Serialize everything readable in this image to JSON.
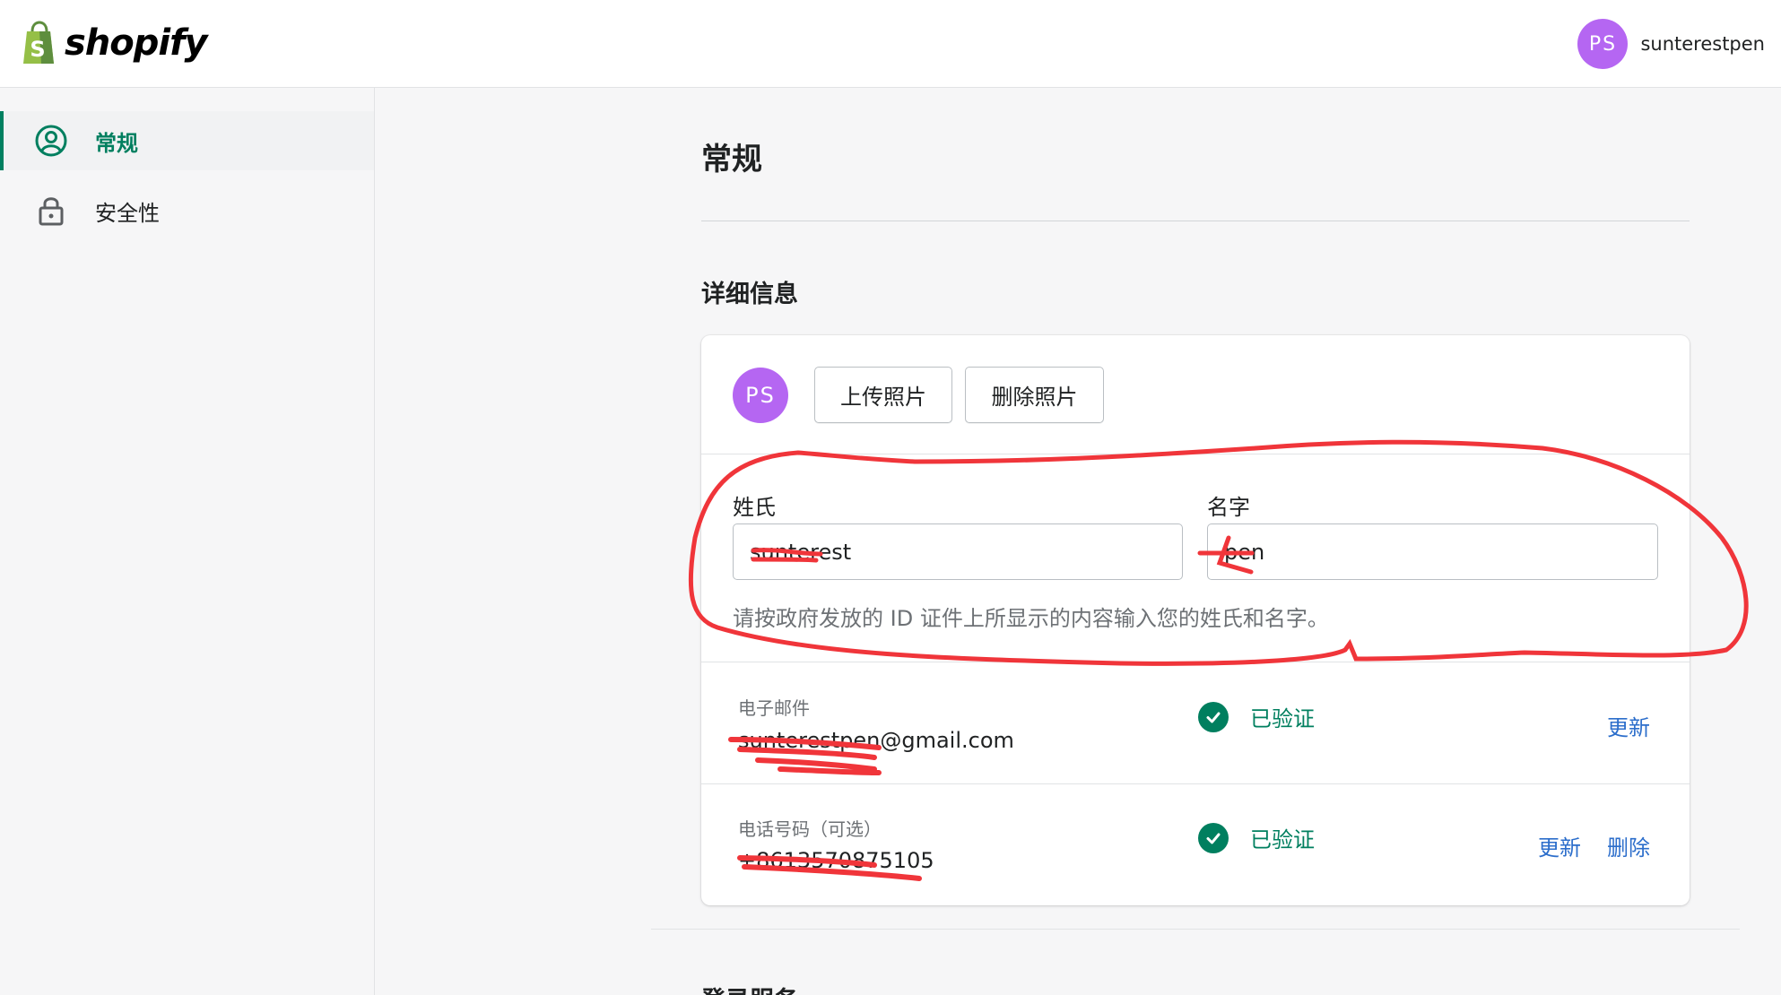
{
  "header": {
    "brand": "shopify",
    "user_initials": "PS",
    "user_name": "sunterestpen"
  },
  "sidebar": {
    "items": [
      {
        "label": "常规",
        "icon": "user-circle-icon",
        "active": true
      },
      {
        "label": "安全性",
        "icon": "lock-icon",
        "active": false
      }
    ]
  },
  "main": {
    "title": "常规",
    "details": {
      "title": "详细信息",
      "avatar_initials": "PS",
      "upload_photo_label": "上传照片",
      "delete_photo_label": "删除照片",
      "last_name_label": "姓氏",
      "last_name_value": "sunterest",
      "first_name_label": "名字",
      "first_name_value": "pen",
      "help_text": "请按政府发放的 ID 证件上所显示的内容输入您的姓氏和名字。",
      "email_label": "电子邮件",
      "email_value": "sunterestpen@gmail.com",
      "email_status": "已验证",
      "email_update_label": "更新",
      "phone_label": "电话号码（可选）",
      "phone_value": "+8613570875105",
      "phone_status": "已验证",
      "phone_update_label": "更新",
      "phone_delete_label": "删除"
    },
    "next_section_title": "登录服务"
  },
  "colors": {
    "accent_green": "#008060",
    "avatar_purple": "#b566f2",
    "link_blue": "#2c6ecb",
    "annotation_red": "#f0353a"
  }
}
